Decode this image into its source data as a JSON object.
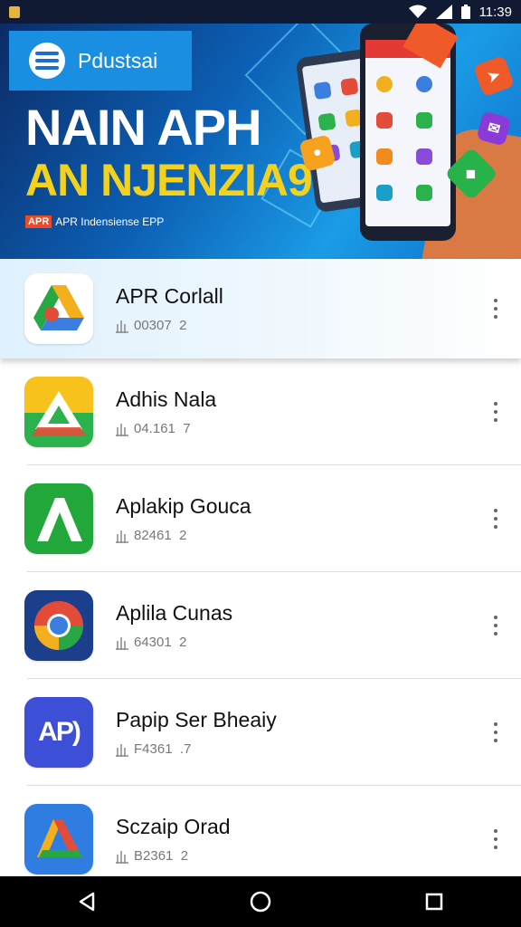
{
  "status_bar": {
    "time": "11:39",
    "icons": [
      "notification-icon",
      "wifi-icon",
      "signal-icon",
      "battery-icon"
    ]
  },
  "banner": {
    "brand": "Pdustsai",
    "headline": "NAIN APH",
    "subheadline": "AN NJENZIA9",
    "tag_badge": "APR",
    "tagline": "APR Indensiense EPP",
    "colors": {
      "background": "#0c5fb4",
      "headline": "#ffffff",
      "subheadline": "#f2d21f",
      "accent": "#e84a2a"
    }
  },
  "apps": [
    {
      "name": "APR Corlall",
      "meta": "00307",
      "meta_suffix": "2",
      "icon": "drive-style-icon",
      "highlighted": true
    },
    {
      "name": "Adhis Nala",
      "meta": "04.161",
      "meta_suffix": "7",
      "icon": "triangle-yellow-green-icon",
      "highlighted": false
    },
    {
      "name": "Aplakip Gouca",
      "meta": "82461",
      "meta_suffix": "2",
      "icon": "a-letter-green-icon",
      "highlighted": false
    },
    {
      "name": "Aplila Cunas",
      "meta": "64301",
      "meta_suffix": "2",
      "icon": "chrome-style-icon",
      "highlighted": false
    },
    {
      "name": "Papip Ser Bheaiy",
      "meta": "F4361",
      "meta_suffix": ".7",
      "icon": "ap-letters-icon",
      "highlighted": false
    },
    {
      "name": "Sczaip Orad",
      "meta": "B2361",
      "meta_suffix": "2",
      "icon": "drive-blue-icon",
      "highlighted": false
    }
  ],
  "nav_bar": {
    "buttons": [
      "back-icon",
      "home-icon",
      "recents-icon"
    ]
  }
}
